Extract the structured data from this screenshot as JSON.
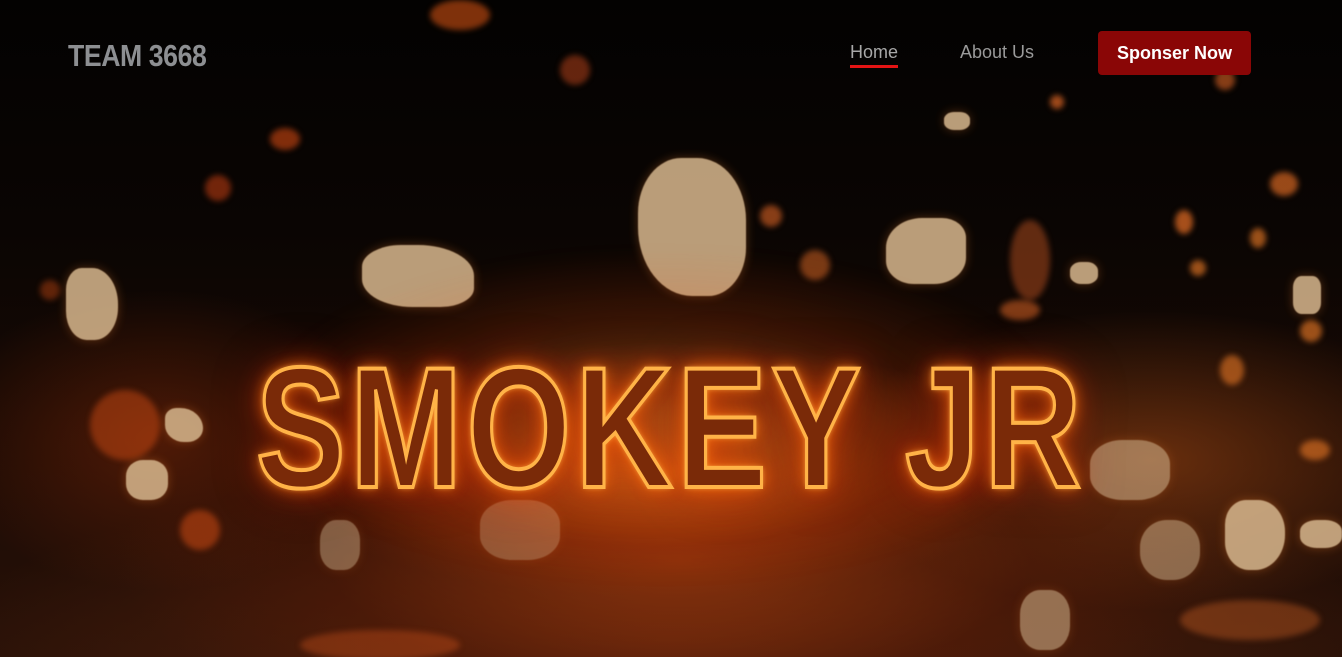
{
  "header": {
    "logo_text": "TEAM 3668",
    "nav": {
      "home_label": "Home",
      "about_label": "About Us"
    },
    "cta_label": "Sponser Now"
  },
  "hero": {
    "title": "SMOKEY JR"
  },
  "colors": {
    "accent_red": "#8a0606",
    "active_underline": "#e41414",
    "flame_orange": "#ffb347"
  }
}
